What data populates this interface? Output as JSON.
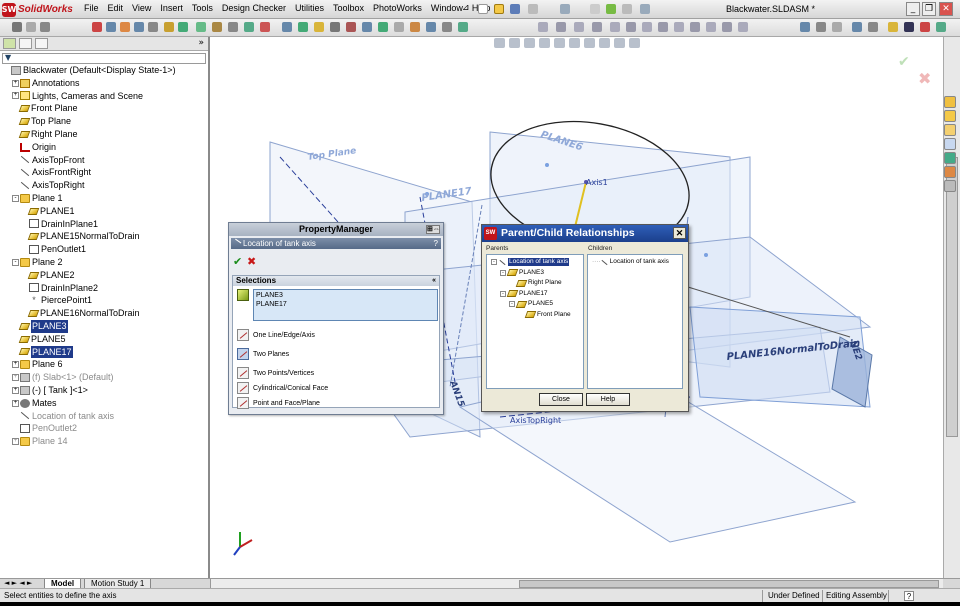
{
  "app": {
    "logo_mark": "SW",
    "name": "SolidWorks",
    "document_title": "Blackwater.SLDASM *"
  },
  "menu": [
    "File",
    "Edit",
    "View",
    "Insert",
    "Tools",
    "Design Checker",
    "Utilities",
    "Toolbox",
    "PhotoWorks",
    "Window",
    "Help"
  ],
  "tree": [
    {
      "label": "Blackwater  (Default<Display State-1>)",
      "indent": 0,
      "icon": "assembly-icon",
      "exp": ""
    },
    {
      "label": "Annotations",
      "indent": 1,
      "icon": "annotations-icon",
      "exp": "+"
    },
    {
      "label": "Lights, Cameras and Scene",
      "indent": 1,
      "icon": "lights-icon",
      "exp": "+"
    },
    {
      "label": "Front Plane",
      "indent": 1,
      "icon": "plane-icon",
      "exp": ""
    },
    {
      "label": "Top Plane",
      "indent": 1,
      "icon": "plane-icon",
      "exp": ""
    },
    {
      "label": "Right Plane",
      "indent": 1,
      "icon": "plane-icon",
      "exp": ""
    },
    {
      "label": "Origin",
      "indent": 1,
      "icon": "origin-icon",
      "exp": ""
    },
    {
      "label": "AxisTopFront",
      "indent": 1,
      "icon": "axis-icon",
      "exp": ""
    },
    {
      "label": "AxisFrontRight",
      "indent": 1,
      "icon": "axis-icon",
      "exp": ""
    },
    {
      "label": "AxisTopRight",
      "indent": 1,
      "icon": "axis-icon",
      "exp": ""
    },
    {
      "label": "Plane 1",
      "indent": 1,
      "icon": "folder-icon",
      "exp": "-"
    },
    {
      "label": "PLANE1",
      "indent": 2,
      "icon": "plane-icon",
      "exp": ""
    },
    {
      "label": "DrainInPlane1",
      "indent": 2,
      "icon": "sketch-icon",
      "exp": ""
    },
    {
      "label": "PLANE15NormalToDrain",
      "indent": 2,
      "icon": "plane-icon",
      "exp": ""
    },
    {
      "label": "PenOutlet1",
      "indent": 2,
      "icon": "sketch-icon",
      "exp": ""
    },
    {
      "label": "Plane 2",
      "indent": 1,
      "icon": "folder-icon",
      "exp": "-"
    },
    {
      "label": "PLANE2",
      "indent": 2,
      "icon": "plane-icon",
      "exp": ""
    },
    {
      "label": "DrainInPlane2",
      "indent": 2,
      "icon": "sketch-icon",
      "exp": ""
    },
    {
      "label": "PiercePoint1",
      "indent": 2,
      "icon": "point-icon",
      "exp": ""
    },
    {
      "label": "PLANE16NormalToDrain",
      "indent": 2,
      "icon": "plane-icon",
      "exp": ""
    },
    {
      "label": "PLANE3",
      "indent": 1,
      "icon": "plane-icon",
      "exp": "",
      "selected": true
    },
    {
      "label": "PLANE5",
      "indent": 1,
      "icon": "plane-icon",
      "exp": ""
    },
    {
      "label": "PLANE17",
      "indent": 1,
      "icon": "plane-icon",
      "exp": "",
      "selected": true
    },
    {
      "label": "Plane 6",
      "indent": 1,
      "icon": "folder-icon",
      "exp": "+"
    },
    {
      "label": "(f) Slab<1> (Default)",
      "indent": 1,
      "icon": "part-icon",
      "exp": "+",
      "grey": true
    },
    {
      "label": "(-) [ Tank ]<1>",
      "indent": 1,
      "icon": "part-icon",
      "exp": "+"
    },
    {
      "label": "Mates",
      "indent": 1,
      "icon": "mates-icon",
      "exp": "+"
    },
    {
      "label": "Location of tank axis",
      "indent": 1,
      "icon": "axis-icon",
      "exp": "",
      "grey": true
    },
    {
      "label": "PenOutlet2",
      "indent": 1,
      "icon": "sketch-icon",
      "exp": "",
      "grey": true
    },
    {
      "label": "Plane 14",
      "indent": 1,
      "icon": "folder-icon",
      "exp": "+",
      "grey": true
    }
  ],
  "graphics": {
    "labels": {
      "top_plane": "Top Plane",
      "plane6": "PLANE6",
      "plane17": "PLANE17",
      "axis1": "Axis1",
      "plane16": "PLANE16NormalToDrain",
      "axis_top_right": "AxisTopRight",
      "plane15_partial": "AN15",
      "plane2_partial": "NE2"
    }
  },
  "property_manager": {
    "title": "PropertyManager",
    "pin_glyph": "⊞⇔",
    "feature": "Location of tank axis",
    "help": "?",
    "ok": "✔",
    "cancel": "✖",
    "selections_title": "Selections",
    "collapse": "«",
    "selected_items": [
      "PLANE3",
      "PLANE17"
    ],
    "options": [
      "One Line/Edge/Axis",
      "Two Planes",
      "Two Points/Vertices",
      "Cylindrical/Conical Face",
      "Point and Face/Plane"
    ]
  },
  "dialog": {
    "title": "Parent/Child Relationships",
    "logo": "SW",
    "close": "✕",
    "parents_label": "Parents",
    "children_label": "Children",
    "parents": [
      {
        "label": "Location of tank axis",
        "level": 0,
        "exp": "-",
        "selected": true
      },
      {
        "label": "PLANE3",
        "level": 1,
        "exp": "-"
      },
      {
        "label": "Right Plane",
        "level": 2,
        "exp": ""
      },
      {
        "label": "PLANE17",
        "level": 1,
        "exp": "-"
      },
      {
        "label": "PLANE5",
        "level": 2,
        "exp": "-"
      },
      {
        "label": "Front Plane",
        "level": 3,
        "exp": ""
      }
    ],
    "children": [
      {
        "label": "Location of tank axis"
      }
    ],
    "close_label": "Close",
    "help_label": "Help"
  },
  "bottom_tabs": [
    "Model",
    "Motion Study 1"
  ],
  "status": {
    "message": "Select entities to define the axis",
    "state": "Under Defined",
    "mode": "Editing Assembly",
    "help": "?"
  },
  "colors": {
    "accent": "#1f3a8a",
    "brand": "#c0141b",
    "plane_blue": "#7f9fd6"
  }
}
